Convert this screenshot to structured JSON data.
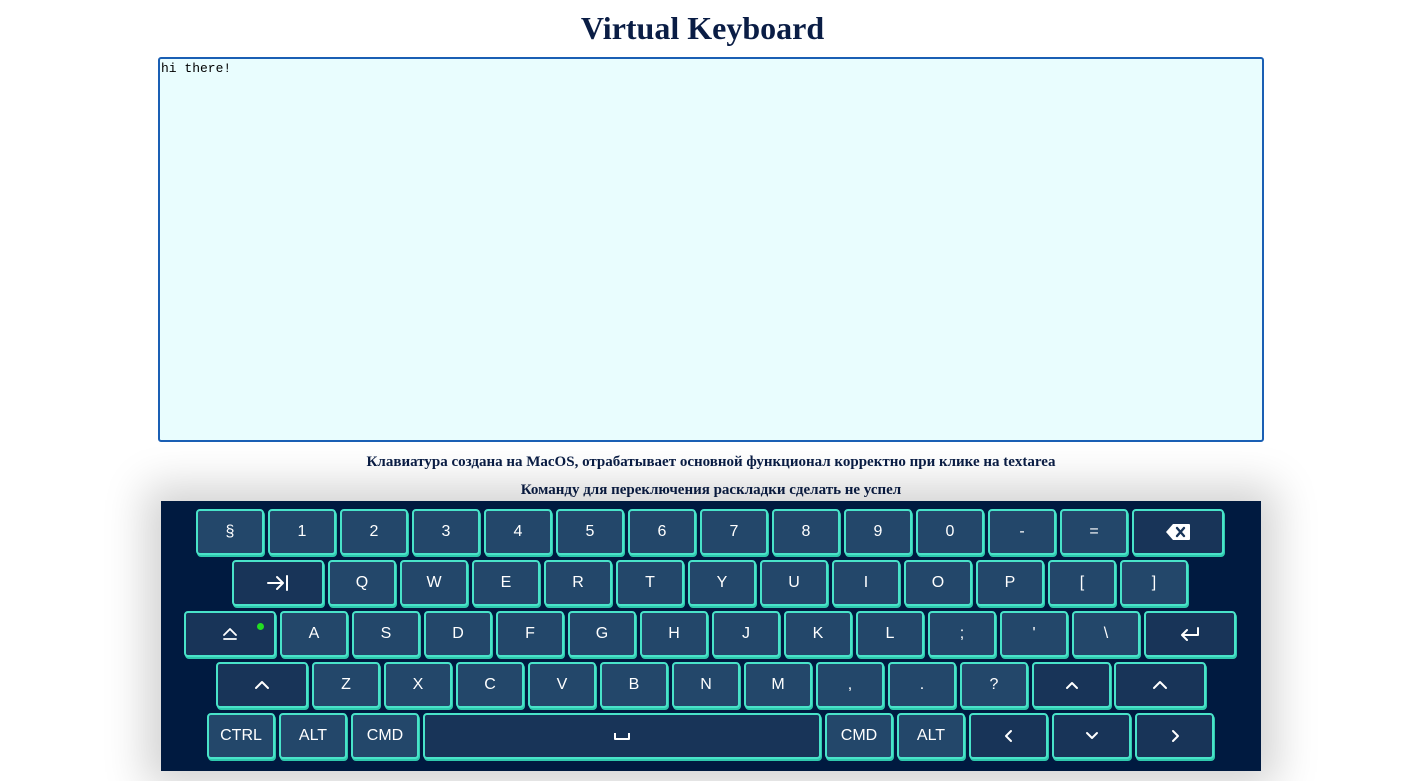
{
  "title": "Virtual Keyboard",
  "textarea": {
    "value": "hi there!"
  },
  "notes": [
    "Клавиатура создана на MacOS, отрабатывает основной функционал корректно при клике на textarea",
    "Команду для переключения раскладки сделать не успел"
  ],
  "colors": {
    "title": "#0a1d45",
    "keyboard_bg": "#001a40",
    "key_bg": "#23476a",
    "key_border": "#49e3c9",
    "textarea_bg": "#e9fdfe",
    "caps_indicator": "#22dd22"
  },
  "keyboard": {
    "rows": [
      [
        {
          "name": "key-section",
          "label": "§"
        },
        {
          "name": "key-1",
          "label": "1"
        },
        {
          "name": "key-2",
          "label": "2"
        },
        {
          "name": "key-3",
          "label": "3"
        },
        {
          "name": "key-4",
          "label": "4"
        },
        {
          "name": "key-5",
          "label": "5"
        },
        {
          "name": "key-6",
          "label": "6"
        },
        {
          "name": "key-7",
          "label": "7"
        },
        {
          "name": "key-8",
          "label": "8"
        },
        {
          "name": "key-9",
          "label": "9"
        },
        {
          "name": "key-0",
          "label": "0"
        },
        {
          "name": "key-minus",
          "label": "-"
        },
        {
          "name": "key-equals",
          "label": "="
        },
        {
          "name": "key-backspace",
          "icon": "backspace-icon"
        }
      ],
      [
        {
          "name": "key-tab",
          "icon": "tab-icon"
        },
        {
          "name": "key-q",
          "label": "Q"
        },
        {
          "name": "key-w",
          "label": "W"
        },
        {
          "name": "key-e",
          "label": "E"
        },
        {
          "name": "key-r",
          "label": "R"
        },
        {
          "name": "key-t",
          "label": "T"
        },
        {
          "name": "key-y",
          "label": "Y"
        },
        {
          "name": "key-u",
          "label": "U"
        },
        {
          "name": "key-i",
          "label": "I"
        },
        {
          "name": "key-o",
          "label": "O"
        },
        {
          "name": "key-p",
          "label": "P"
        },
        {
          "name": "key-bracket-left",
          "label": "["
        },
        {
          "name": "key-bracket-right",
          "label": "]"
        }
      ],
      [
        {
          "name": "key-capslock",
          "icon": "capslock-icon",
          "indicator": true
        },
        {
          "name": "key-a",
          "label": "A"
        },
        {
          "name": "key-s",
          "label": "S"
        },
        {
          "name": "key-d",
          "label": "D"
        },
        {
          "name": "key-f",
          "label": "F"
        },
        {
          "name": "key-g",
          "label": "G"
        },
        {
          "name": "key-h",
          "label": "H"
        },
        {
          "name": "key-j",
          "label": "J"
        },
        {
          "name": "key-k",
          "label": "K"
        },
        {
          "name": "key-l",
          "label": "L"
        },
        {
          "name": "key-semicolon",
          "label": ";"
        },
        {
          "name": "key-quote",
          "label": "'"
        },
        {
          "name": "key-backslash",
          "label": "\\"
        },
        {
          "name": "key-enter",
          "icon": "enter-icon"
        }
      ],
      [
        {
          "name": "key-shift-left",
          "icon": "shift-icon"
        },
        {
          "name": "key-z",
          "label": "Z"
        },
        {
          "name": "key-x",
          "label": "X"
        },
        {
          "name": "key-c",
          "label": "C"
        },
        {
          "name": "key-v",
          "label": "V"
        },
        {
          "name": "key-b",
          "label": "B"
        },
        {
          "name": "key-n",
          "label": "N"
        },
        {
          "name": "key-m",
          "label": "M"
        },
        {
          "name": "key-comma",
          "label": ","
        },
        {
          "name": "key-period",
          "label": "."
        },
        {
          "name": "key-question",
          "label": "?"
        },
        {
          "name": "key-arrow-up",
          "icon": "arrow-up-icon"
        },
        {
          "name": "key-shift-right",
          "icon": "shift-icon"
        }
      ],
      [
        {
          "name": "key-ctrl",
          "label": "CTRL"
        },
        {
          "name": "key-alt-left",
          "label": "ALT"
        },
        {
          "name": "key-cmd-left",
          "label": "CMD"
        },
        {
          "name": "key-space",
          "icon": "space-icon"
        },
        {
          "name": "key-cmd-right",
          "label": "CMD"
        },
        {
          "name": "key-alt-right",
          "label": "ALT"
        },
        {
          "name": "key-arrow-left",
          "icon": "arrow-left-icon"
        },
        {
          "name": "key-arrow-down",
          "icon": "arrow-down-icon"
        },
        {
          "name": "key-arrow-right",
          "icon": "arrow-right-icon"
        }
      ]
    ]
  }
}
